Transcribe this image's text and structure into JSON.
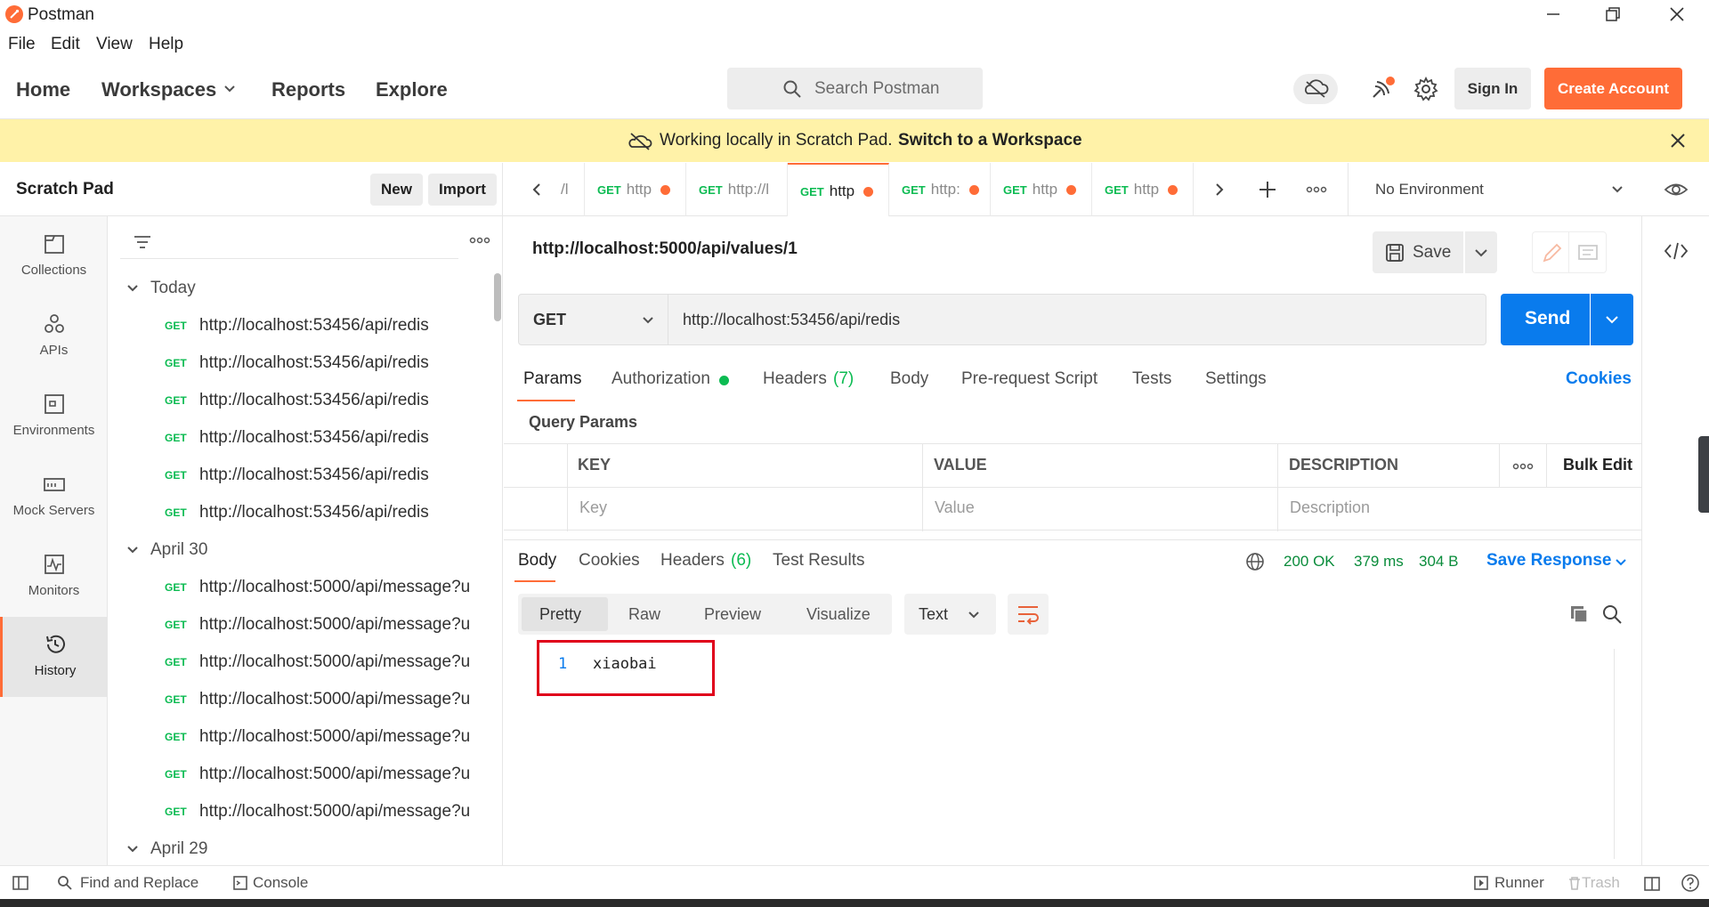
{
  "window": {
    "title": "Postman"
  },
  "menu": [
    "File",
    "Edit",
    "View",
    "Help"
  ],
  "nav": {
    "home": "Home",
    "workspaces": "Workspaces",
    "reports": "Reports",
    "explore": "Explore"
  },
  "search": {
    "placeholder": "Search Postman"
  },
  "account": {
    "sign_in": "Sign In",
    "create_account": "Create Account"
  },
  "banner": {
    "text": "Working locally in Scratch Pad.",
    "link": "Switch to a Workspace"
  },
  "scratch": {
    "title": "Scratch Pad",
    "new_label": "New",
    "import_label": "Import"
  },
  "sidebar": {
    "items": [
      {
        "label": "Collections",
        "icon": "collections-icon"
      },
      {
        "label": "APIs",
        "icon": "apis-icon"
      },
      {
        "label": "Environments",
        "icon": "environments-icon"
      },
      {
        "label": "Mock Servers",
        "icon": "mock-servers-icon"
      },
      {
        "label": "Monitors",
        "icon": "monitors-icon"
      },
      {
        "label": "History",
        "icon": "history-icon",
        "active": true
      }
    ]
  },
  "history": {
    "groups": [
      {
        "label": "Today",
        "rows": [
          {
            "method": "GET",
            "url": "http://localhost:53456/api/redis"
          },
          {
            "method": "GET",
            "url": "http://localhost:53456/api/redis"
          },
          {
            "method": "GET",
            "url": "http://localhost:53456/api/redis"
          },
          {
            "method": "GET",
            "url": "http://localhost:53456/api/redis"
          },
          {
            "method": "GET",
            "url": "http://localhost:53456/api/redis"
          },
          {
            "method": "GET",
            "url": "http://localhost:53456/api/redis"
          }
        ]
      },
      {
        "label": "April 30",
        "rows": [
          {
            "method": "GET",
            "url": "http://localhost:5000/api/message?u"
          },
          {
            "method": "GET",
            "url": "http://localhost:5000/api/message?u"
          },
          {
            "method": "GET",
            "url": "http://localhost:5000/api/message?u"
          },
          {
            "method": "GET",
            "url": "http://localhost:5000/api/message?u"
          },
          {
            "method": "GET",
            "url": "http://localhost:5000/api/message?u"
          },
          {
            "method": "GET",
            "url": "http://localhost:5000/api/message?u"
          },
          {
            "method": "GET",
            "url": "http://localhost:5000/api/message?u"
          }
        ]
      },
      {
        "label": "April 29",
        "rows": []
      }
    ]
  },
  "tabs": [
    {
      "method": "",
      "label": "/l",
      "dot": false
    },
    {
      "method": "GET",
      "label": "http",
      "dot": true
    },
    {
      "method": "GET",
      "label": "http://l",
      "dot": false
    },
    {
      "method": "GET",
      "label": "http",
      "dot": true,
      "active": true
    },
    {
      "method": "GET",
      "label": "http:",
      "dot": true
    },
    {
      "method": "GET",
      "label": "http",
      "dot": true
    },
    {
      "method": "GET",
      "label": "http",
      "dot": true
    }
  ],
  "environment": {
    "selected": "No Environment"
  },
  "request": {
    "name": "http://localhost:5000/api/values/1",
    "save_label": "Save",
    "method": "GET",
    "url": "http://localhost:53456/api/redis",
    "send_label": "Send",
    "tabs": {
      "params": "Params",
      "authorization": "Authorization",
      "headers": "Headers",
      "headers_count": "(7)",
      "body": "Body",
      "prerequest": "Pre-request Script",
      "tests": "Tests",
      "settings": "Settings",
      "cookies": "Cookies"
    },
    "query_params_title": "Query Params",
    "table": {
      "key_header": "KEY",
      "value_header": "VALUE",
      "description_header": "DESCRIPTION",
      "bulk_edit": "Bulk Edit",
      "key_placeholder": "Key",
      "value_placeholder": "Value",
      "description_placeholder": "Description"
    }
  },
  "response": {
    "tabs": {
      "body": "Body",
      "cookies": "Cookies",
      "headers": "Headers",
      "headers_count": "(6)",
      "test_results": "Test Results"
    },
    "status": "200 OK",
    "time": "379 ms",
    "size": "304 B",
    "save_response": "Save Response",
    "views": {
      "pretty": "Pretty",
      "raw": "Raw",
      "preview": "Preview",
      "visualize": "Visualize"
    },
    "format": "Text",
    "lines": [
      {
        "n": "1",
        "text": "xiaobai"
      }
    ]
  },
  "statusbar": {
    "find_replace": "Find and Replace",
    "console": "Console",
    "runner": "Runner",
    "trash": "Trash"
  },
  "colors": {
    "accent": "#ff6c37",
    "send": "#097bed",
    "get": "#0cbb52",
    "banner": "#fff2a8",
    "highlight_box": "#e0001b"
  }
}
